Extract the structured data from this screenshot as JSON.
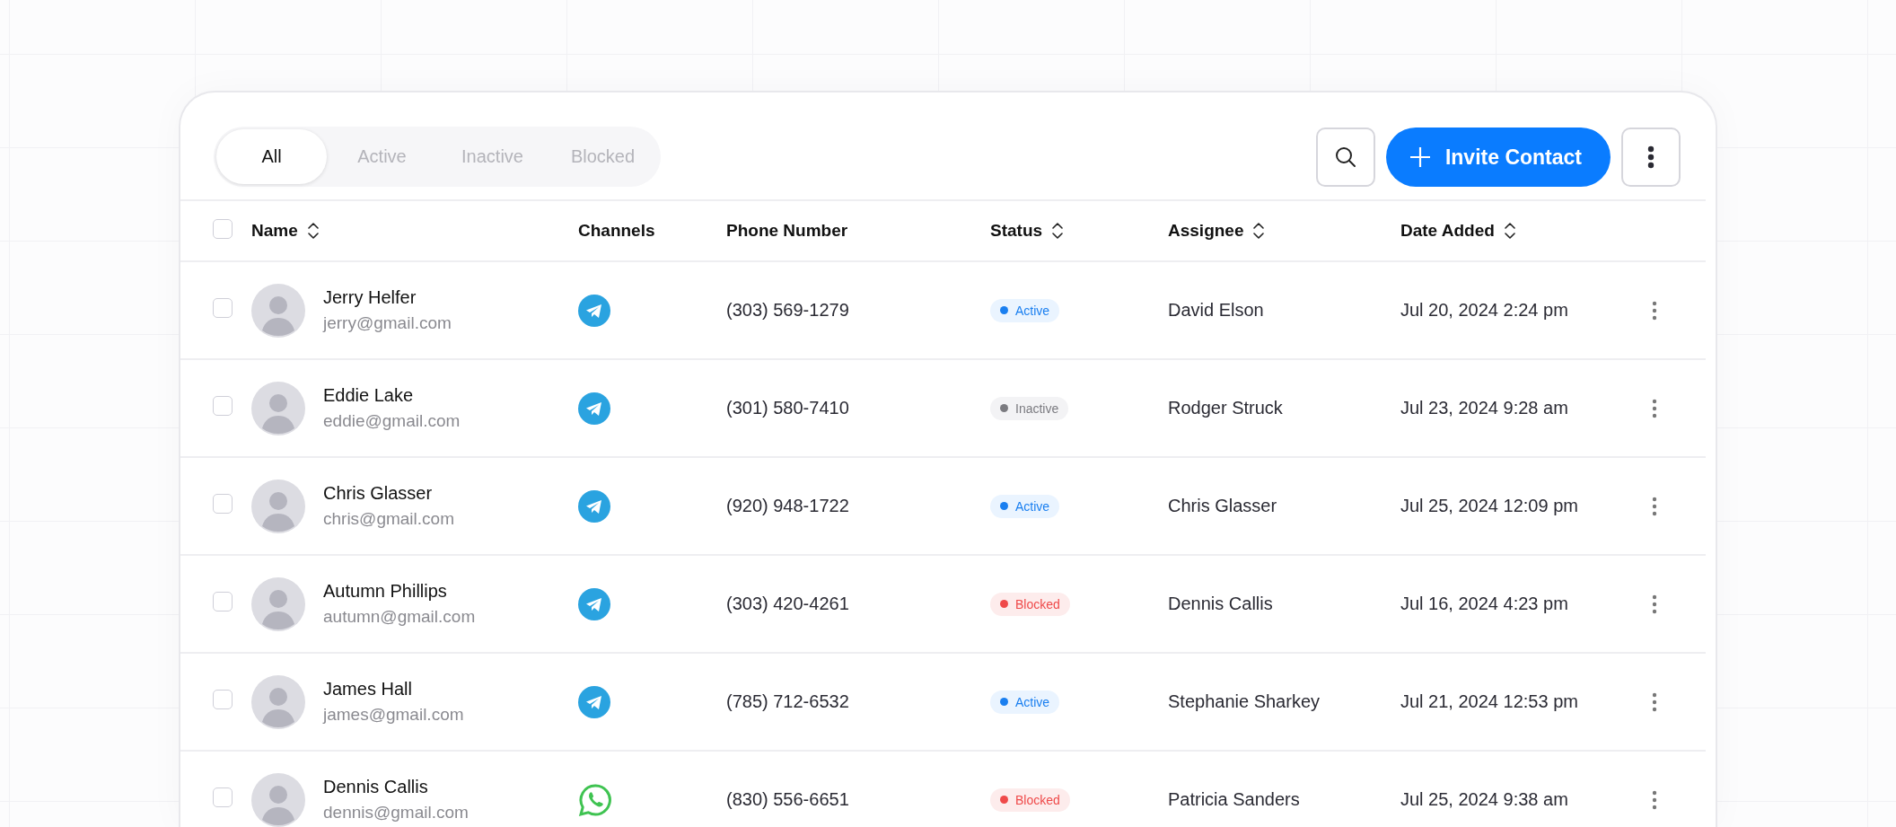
{
  "tabs": [
    {
      "label": "All",
      "selected": true
    },
    {
      "label": "Active",
      "selected": false
    },
    {
      "label": "Inactive",
      "selected": false
    },
    {
      "label": "Blocked",
      "selected": false
    }
  ],
  "toolbar": {
    "invite_button": "Invite Contact"
  },
  "table": {
    "select_all": {
      "checked": false
    },
    "columns": [
      {
        "label": "Name",
        "sortable": true
      },
      {
        "label": "Channels",
        "sortable": false
      },
      {
        "label": "Phone Number",
        "sortable": false
      },
      {
        "label": "Status",
        "sortable": true
      },
      {
        "label": "Assignee",
        "sortable": true
      },
      {
        "label": "Date Added",
        "sortable": true
      }
    ],
    "rows": [
      {
        "checked": false,
        "name": "Jerry Helfer",
        "email": "jerry@gmail.com",
        "channel": {
          "kind": "telegram"
        },
        "phone": "(303) 569-1279",
        "status": {
          "kind": "active",
          "label": "Active"
        },
        "assignee": "David Elson",
        "date_added": "Jul 20, 2024 2:24 pm"
      },
      {
        "checked": false,
        "name": "Eddie Lake",
        "email": "eddie@gmail.com",
        "channel": {
          "kind": "telegram"
        },
        "phone": "(301) 580-7410",
        "status": {
          "kind": "inactive",
          "label": "Inactive"
        },
        "assignee": "Rodger Struck",
        "date_added": "Jul 23, 2024 9:28 am"
      },
      {
        "checked": false,
        "name": "Chris Glasser",
        "email": "chris@gmail.com",
        "channel": {
          "kind": "telegram"
        },
        "phone": "(920) 948-1722",
        "status": {
          "kind": "active",
          "label": "Active"
        },
        "assignee": "Chris Glasser",
        "date_added": "Jul 25, 2024 12:09 pm"
      },
      {
        "checked": false,
        "name": "Autumn Phillips",
        "email": "autumn@gmail.com",
        "channel": {
          "kind": "telegram"
        },
        "phone": "(303) 420-4261",
        "status": {
          "kind": "blocked",
          "label": "Blocked"
        },
        "assignee": "Dennis Callis",
        "date_added": "Jul 16, 2024 4:23 pm"
      },
      {
        "checked": false,
        "name": "James Hall",
        "email": "james@gmail.com",
        "channel": {
          "kind": "telegram"
        },
        "phone": "(785) 712-6532",
        "status": {
          "kind": "active",
          "label": "Active"
        },
        "assignee": "Stephanie Sharkey",
        "date_added": "Jul 21, 2024 12:53 pm"
      },
      {
        "checked": false,
        "name": "Dennis Callis",
        "email": "dennis@gmail.com",
        "channel": {
          "kind": "whatsapp"
        },
        "phone": "(830) 556-6651",
        "status": {
          "kind": "blocked",
          "label": "Blocked"
        },
        "assignee": "Patricia Sanders",
        "date_added": "Jul 25, 2024 9:38 am"
      }
    ]
  }
}
